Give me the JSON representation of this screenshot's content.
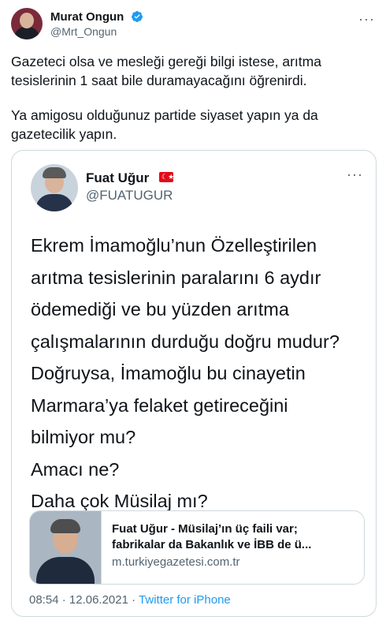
{
  "author": {
    "name": "Murat Ongun",
    "handle": "@Mrt_Ongun",
    "more_glyph": "···"
  },
  "tweet": {
    "paragraphs": [
      "Gazeteci olsa ve mesleği gereği bilgi istese, arıtma tesislerinin 1 saat bile duramayacağını öğrenirdi.",
      "Ya amigosu olduğunuz partide siyaset yapın ya da gazetecilik yapın."
    ]
  },
  "quoted": {
    "name": "Fuat Uğur",
    "flag": "Turkey",
    "handle": "@FUATUGUR",
    "more_glyph": "···",
    "lines": [
      "Ekrem İmamoğlu’nun Özelleştirilen",
      "arıtma tesislerinin paralarını 6 aydır",
      "ödemediği ve bu yüzden arıtma",
      "çalışmalarının durduğu doğru mudur?",
      "Doğruysa, İmamoğlu bu cinayetin",
      "Marmara’ya felaket getireceğini",
      "bilmiyor mu?",
      "Amacı ne?",
      "Daha çok Müsilaj mı?"
    ],
    "link": {
      "title_line1": "Fuat Uğur - Müsilaj’ın üç faili var;",
      "title_line2": "fabrikalar da Bakanlık ve İBB de ü...",
      "domain": "m.turkiyegazetesi.com.tr"
    },
    "meta": {
      "time": "08:54",
      "separator": "·",
      "date": "12.06.2021",
      "source": "Twitter for iPhone"
    }
  },
  "colors": {
    "verified": "#1d9bf0",
    "link": "#1d9bf0",
    "secondary_text": "#536471",
    "border": "#cfd9de"
  }
}
